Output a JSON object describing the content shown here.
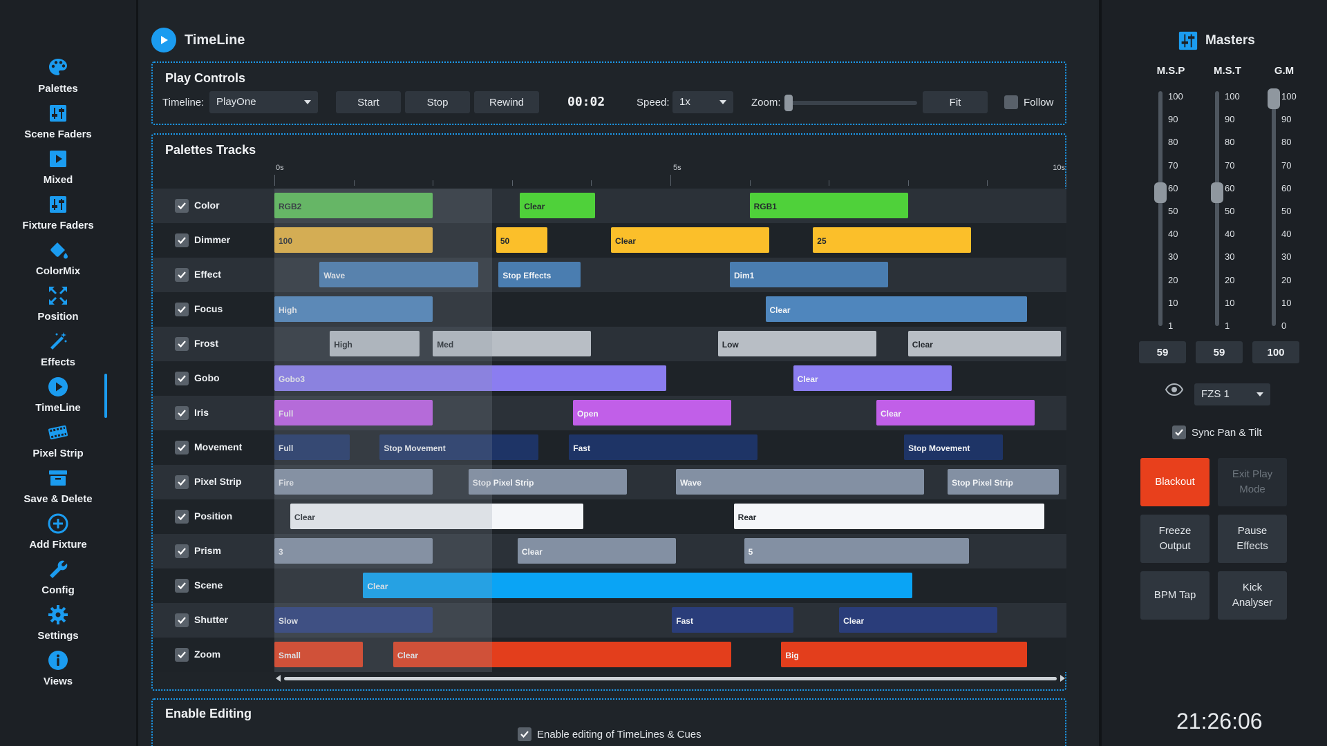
{
  "sidebar": {
    "items": [
      {
        "label": "Palettes",
        "icon": "palette-icon"
      },
      {
        "label": "Scene Faders",
        "icon": "faders-icon"
      },
      {
        "label": "Mixed",
        "icon": "play-square-icon"
      },
      {
        "label": "Fixture Faders",
        "icon": "faders-icon"
      },
      {
        "label": "ColorMix",
        "icon": "paint-bucket-icon"
      },
      {
        "label": "Position",
        "icon": "position-arrows-icon"
      },
      {
        "label": "Effects",
        "icon": "magic-wand-icon"
      },
      {
        "label": "TimeLine",
        "icon": "play-circle-icon"
      },
      {
        "label": "Pixel Strip",
        "icon": "film-strip-icon"
      },
      {
        "label": "Save & Delete",
        "icon": "archive-box-icon"
      },
      {
        "label": "Add Fixture",
        "icon": "add-circle-icon"
      },
      {
        "label": "Config",
        "icon": "wrench-icon"
      },
      {
        "label": "Settings",
        "icon": "gear-icon"
      },
      {
        "label": "Views",
        "icon": "info-circle-icon"
      }
    ],
    "active": "TimeLine"
  },
  "header": {
    "title": "TimeLine"
  },
  "play_controls": {
    "title": "Play Controls",
    "timeline_label": "Timeline:",
    "timeline_value": "PlayOne",
    "start": "Start",
    "stop": "Stop",
    "rewind": "Rewind",
    "time": "00:02",
    "speed_label": "Speed:",
    "speed_value": "1x",
    "zoom_label": "Zoom:",
    "zoom_level": 0,
    "fit": "Fit",
    "follow": "Follow",
    "follow_checked": false
  },
  "tracks": {
    "title": "Palettes Tracks",
    "ruler": {
      "start_label": "0s",
      "mid_label": "5s",
      "end_label": "10s",
      "duration_s": 10
    },
    "playhead_s": 2.75,
    "rows": [
      {
        "name": "Color",
        "checked": true,
        "clips": [
          {
            "label": "RGB2",
            "start": 0,
            "end": 2.0,
            "color": "#5bbf55"
          },
          {
            "label": "Clear",
            "start": 3.1,
            "end": 4.05,
            "color": "#4fd13a"
          },
          {
            "label": "RGB1",
            "start": 6.0,
            "end": 8.0,
            "color": "#4fd13a"
          }
        ]
      },
      {
        "name": "Dimmer",
        "checked": true,
        "clips": [
          {
            "label": "100",
            "start": 0,
            "end": 2.0,
            "color": "#e8b43e"
          },
          {
            "label": "50",
            "start": 2.8,
            "end": 3.45,
            "color": "#fbbf2a"
          },
          {
            "label": "Clear",
            "start": 4.25,
            "end": 6.25,
            "color": "#fbbf2a"
          },
          {
            "label": "25",
            "start": 6.8,
            "end": 8.8,
            "color": "#fbbf2a"
          }
        ]
      },
      {
        "name": "Effect",
        "checked": true,
        "clips": [
          {
            "label": "Wave",
            "start": 0.57,
            "end": 2.57,
            "color": "#4a7db0"
          },
          {
            "label": "Stop Effects",
            "start": 2.83,
            "end": 3.87,
            "color": "#4a7db0"
          },
          {
            "label": "Dim1",
            "start": 5.75,
            "end": 7.75,
            "color": "#4a7db0"
          }
        ]
      },
      {
        "name": "Focus",
        "checked": true,
        "clips": [
          {
            "label": "High",
            "start": 0,
            "end": 2.0,
            "color": "#4f86bd"
          },
          {
            "label": "Clear",
            "start": 6.2,
            "end": 9.5,
            "color": "#4f86bd"
          }
        ]
      },
      {
        "name": "Frost",
        "checked": true,
        "clips": [
          {
            "label": "High",
            "start": 0.7,
            "end": 1.83,
            "color": "#b8bec5"
          },
          {
            "label": "Med",
            "start": 2.0,
            "end": 4.0,
            "color": "#b8bec5"
          },
          {
            "label": "Low",
            "start": 5.6,
            "end": 7.6,
            "color": "#b8bec5"
          },
          {
            "label": "Clear",
            "start": 8.0,
            "end": 9.93,
            "color": "#b8bec5"
          }
        ]
      },
      {
        "name": "Gobo",
        "checked": true,
        "clips": [
          {
            "label": "Gobo3",
            "start": 0,
            "end": 4.95,
            "color": "#8b7df0"
          },
          {
            "label": "Clear",
            "start": 6.55,
            "end": 8.55,
            "color": "#8b7df0"
          }
        ]
      },
      {
        "name": "Iris",
        "checked": true,
        "clips": [
          {
            "label": "Full",
            "start": 0,
            "end": 2.0,
            "color": "#c15fe8"
          },
          {
            "label": "Open",
            "start": 3.77,
            "end": 5.77,
            "color": "#c15fe8"
          },
          {
            "label": "Clear",
            "start": 7.6,
            "end": 9.6,
            "color": "#c15fe8"
          }
        ]
      },
      {
        "name": "Movement",
        "checked": true,
        "clips": [
          {
            "label": "Full",
            "start": 0,
            "end": 0.95,
            "color": "#1e3466"
          },
          {
            "label": "Stop Movement",
            "start": 1.33,
            "end": 3.33,
            "color": "#1e3466"
          },
          {
            "label": "Fast",
            "start": 3.72,
            "end": 6.1,
            "color": "#1e3466"
          },
          {
            "label": "Stop Movement",
            "start": 7.95,
            "end": 9.2,
            "color": "#1e3466"
          }
        ]
      },
      {
        "name": "Pixel Strip",
        "checked": true,
        "clips": [
          {
            "label": "Fire",
            "start": 0,
            "end": 2.0,
            "color": "#8390a3"
          },
          {
            "label": "Stop Pixel Strip",
            "start": 2.45,
            "end": 4.45,
            "color": "#8390a3"
          },
          {
            "label": "Wave",
            "start": 5.07,
            "end": 8.2,
            "color": "#8390a3"
          },
          {
            "label": "Stop Pixel Strip",
            "start": 8.5,
            "end": 9.9,
            "color": "#8390a3"
          }
        ]
      },
      {
        "name": "Position",
        "checked": true,
        "clips": [
          {
            "label": "Clear",
            "start": 0.2,
            "end": 3.9,
            "color": "#f4f6f9"
          },
          {
            "label": "Rear",
            "start": 5.8,
            "end": 9.72,
            "color": "#f4f6f9"
          }
        ]
      },
      {
        "name": "Prism",
        "checked": true,
        "clips": [
          {
            "label": "3",
            "start": 0,
            "end": 2.0,
            "color": "#8390a3"
          },
          {
            "label": "Clear",
            "start": 3.07,
            "end": 5.07,
            "color": "#8390a3"
          },
          {
            "label": "5",
            "start": 5.93,
            "end": 8.77,
            "color": "#8390a3"
          }
        ]
      },
      {
        "name": "Scene",
        "checked": true,
        "clips": [
          {
            "label": "Clear",
            "start": 1.12,
            "end": 8.05,
            "color": "#0aa4f5"
          }
        ]
      },
      {
        "name": "Shutter",
        "checked": true,
        "clips": [
          {
            "label": "Slow",
            "start": 0,
            "end": 2.0,
            "color": "#2a3d7a"
          },
          {
            "label": "Fast",
            "start": 5.02,
            "end": 6.55,
            "color": "#2a3d7a"
          },
          {
            "label": "Clear",
            "start": 7.13,
            "end": 9.13,
            "color": "#2a3d7a"
          }
        ]
      },
      {
        "name": "Zoom",
        "checked": true,
        "clips": [
          {
            "label": "Small",
            "start": 0,
            "end": 1.12,
            "color": "#e33e1c"
          },
          {
            "label": "Clear",
            "start": 1.5,
            "end": 5.77,
            "color": "#e33e1c"
          },
          {
            "label": "Big",
            "start": 6.4,
            "end": 9.5,
            "color": "#e33e1c"
          }
        ]
      }
    ]
  },
  "enable_editing": {
    "title": "Enable Editing",
    "label": "Enable editing of TimeLines & Cues",
    "checked": true
  },
  "masters": {
    "title": "Masters",
    "faders": [
      {
        "name": "M.S.P",
        "value": "59",
        "level": 0.59,
        "ticks": [
          "100",
          "90",
          "80",
          "70",
          "60",
          "50",
          "40",
          "30",
          "20",
          "10",
          "1"
        ]
      },
      {
        "name": "M.S.T",
        "value": "59",
        "level": 0.59,
        "ticks": [
          "100",
          "90",
          "80",
          "70",
          "60",
          "50",
          "40",
          "30",
          "20",
          "10",
          "1"
        ]
      },
      {
        "name": "G.M",
        "value": "100",
        "level": 1.0,
        "ticks": [
          "100",
          "90",
          "80",
          "70",
          "60",
          "50",
          "40",
          "30",
          "20",
          "10",
          "0"
        ]
      }
    ],
    "fixture_select": "FZS 1",
    "sync_label": "Sync Pan & Tilt",
    "sync_checked": true,
    "buttons": {
      "blackout": "Blackout",
      "exit_play_mode": "Exit Play Mode",
      "freeze_output": "Freeze Output",
      "pause_effects": "Pause Effects",
      "bpm_tap": "BPM Tap",
      "kick_analyser": "Kick Analyser"
    },
    "clock": "21:26:06"
  },
  "colors": {
    "accent": "#1b9cf0",
    "blackout": "#e8401c",
    "panel_bg": "#1f2429"
  }
}
